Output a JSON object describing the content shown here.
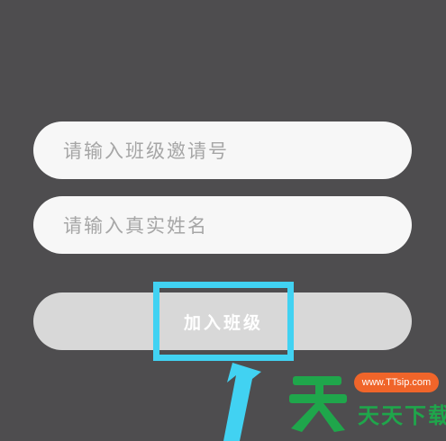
{
  "form": {
    "class_code_placeholder": "请输入班级邀请号",
    "real_name_placeholder": "请输入真实姓名",
    "join_button_label": "加入班级"
  },
  "overlay": {
    "highlight_color": "#41d2f2",
    "arrow_icon": "pointer-arrow-icon"
  },
  "watermark": {
    "logo_icon": "tian-logo-icon",
    "url": "www.TTsip.com",
    "name": "天天下载",
    "brand_green": "#1fa64b",
    "brand_orange": "#f0652a"
  },
  "colors": {
    "background": "#4e4d4f",
    "field_background": "#f7f7f7",
    "button_background": "#d8d8d8",
    "placeholder_text": "#a6a6a6"
  }
}
